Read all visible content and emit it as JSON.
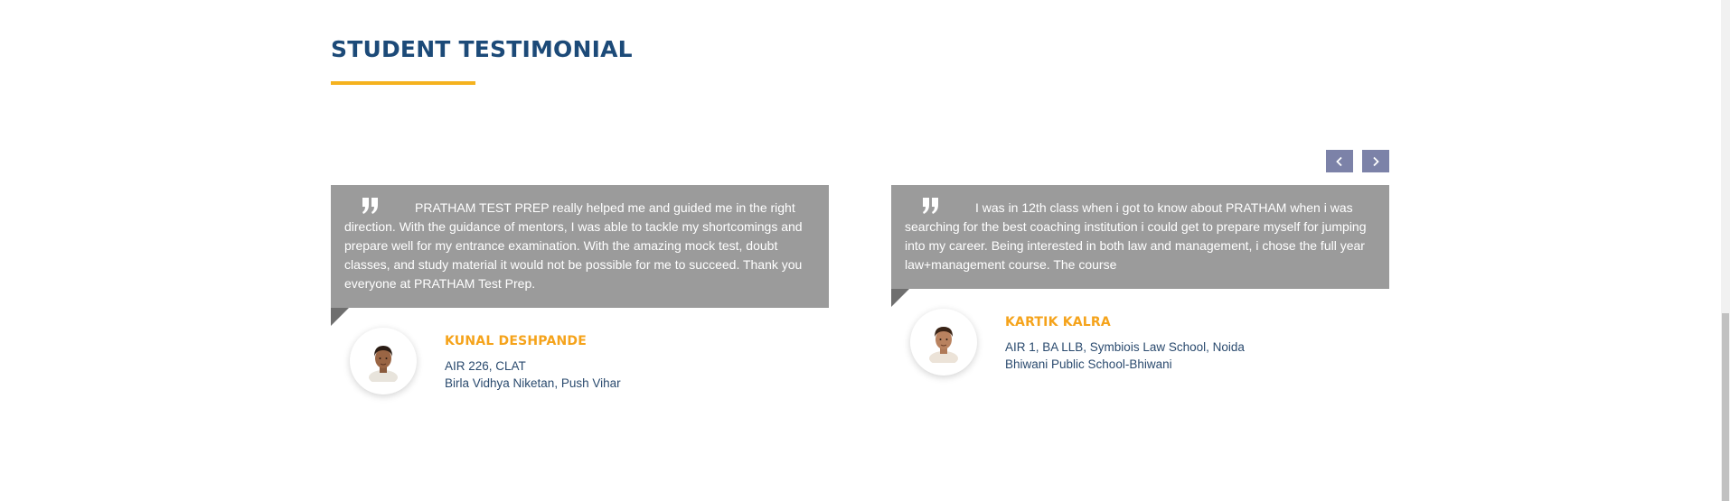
{
  "section": {
    "title": "STUDENT TESTIMONIAL"
  },
  "colors": {
    "title": "#1c4a78",
    "accent": "#f5b21e",
    "quote_bg": "#9b9b9b",
    "nav_bg": "#7c82a8"
  },
  "carousel": {
    "prev_icon": "chevron-left-icon",
    "next_icon": "chevron-right-icon"
  },
  "testimonials": [
    {
      "quote": "PRATHAM TEST PREP really helped me and guided me in the right direction. With the guidance of mentors, I was able to tackle my shortcomings and prepare well for my entrance examination. With the amazing mock test, doubt classes, and study material it would not be possible for me to succeed. Thank you everyone at PRATHAM Test Prep.",
      "name": "KUNAL DESHPANDE",
      "rank": "AIR 226, CLAT",
      "school": "Birla Vidhya Niketan, Push Vihar"
    },
    {
      "quote": "I was in 12th class when i got to know about PRATHAM when i was searching for the best coaching institution i could get to prepare myself for jumping into my career. Being interested in both law and management, i chose the full year law+management course. The course",
      "name": "KARTIK KALRA",
      "rank": "AIR 1, BA LLB, Symbiois Law School, Noida",
      "school": "Bhiwani Public School-Bhiwani"
    }
  ]
}
